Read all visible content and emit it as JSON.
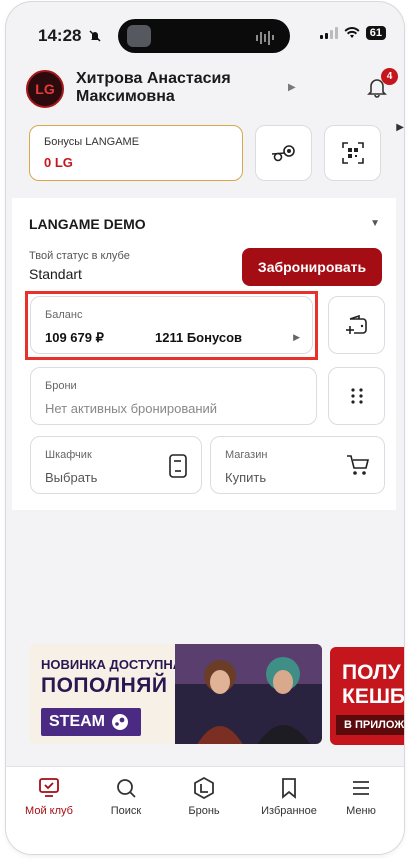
{
  "status_bar": {
    "time": "14:28",
    "battery": "61"
  },
  "profile": {
    "name_line1": "Хитрова Анастасия",
    "name_line2": "Максимовна",
    "avatar_text": "LG",
    "notification_count": "4"
  },
  "bonus": {
    "title": "Бонусы LANGAME",
    "value": "0 LG"
  },
  "club": {
    "name": "LANGAME DEMO",
    "status_label": "Твой статус в клубе",
    "status_value": "Standart",
    "book_button": "Забронировать"
  },
  "balance": {
    "label": "Баланс",
    "amount": "109 679 ₽",
    "bonuses": "1211 Бонусов"
  },
  "bookings": {
    "label": "Брони",
    "value": "Нет активных бронирований"
  },
  "locker": {
    "label": "Шкафчик",
    "value": "Выбрать"
  },
  "shop": {
    "label": "Магазин",
    "value": "Купить"
  },
  "banners": {
    "first": {
      "line1": "НОВИНКА ДОСТУПНА!",
      "line2": "ПОПОЛНЯЙ",
      "line3": "STEAM"
    },
    "second": {
      "line1": "ПОЛУ",
      "line2": "КЕШБ",
      "line3": "В ПРИЛОЖ"
    }
  },
  "nav": {
    "items": [
      {
        "label": "Мой клуб"
      },
      {
        "label": "Поиск"
      },
      {
        "label": "Бронь"
      },
      {
        "label": "Избранное"
      },
      {
        "label": "Меню"
      }
    ]
  },
  "colors": {
    "accent": "#a30d13",
    "highlight": "#e8312d",
    "bonus_border": "#d9a64d"
  }
}
